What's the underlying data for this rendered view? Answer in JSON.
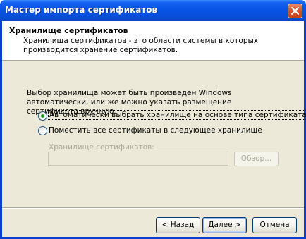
{
  "window": {
    "title": "Мастер импорта сертификатов"
  },
  "header": {
    "title": "Хранилище сертификатов",
    "description": "Хранилища сертификатов - это области системы в которых производится хранение сертификатов."
  },
  "body": {
    "instruction": "Выбор хранилища может быть произведен Windows автоматически, или же можно указать размещение сертификата вручную.",
    "options": [
      {
        "label": "Автоматически выбрать хранилище на основе типа сертификата",
        "selected": true
      },
      {
        "label": "Поместить все сертификаты в следующее хранилище",
        "selected": false
      }
    ],
    "store": {
      "label": "Хранилище сертификатов:",
      "value": "",
      "browse_label": "Обзор..."
    }
  },
  "buttons": {
    "back": "< Назад",
    "next": "Далее >",
    "cancel": "Отмена"
  },
  "colors": {
    "titlebar": "#0a55e8",
    "dialog_bg": "#ece9d8",
    "radio_dot": "#21a121"
  }
}
